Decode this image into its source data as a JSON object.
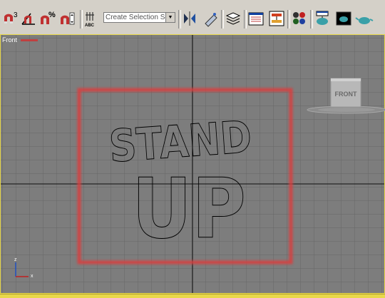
{
  "toolbar": {
    "selection_set_placeholder": "Create Selection Set",
    "snap_label": "3",
    "percent_label": "%",
    "abc_label": "ABC"
  },
  "viewport": {
    "label": "Front",
    "view_cube_label": "FRONT",
    "axis_x": "x",
    "axis_z": "z"
  },
  "scene": {
    "line1": "STAND",
    "line2": "UP"
  },
  "colors": {
    "viewport_bg": "#7d7d7d",
    "grid": "#686868",
    "selection_red": "#d84040",
    "active_border": "#e8d84a"
  }
}
